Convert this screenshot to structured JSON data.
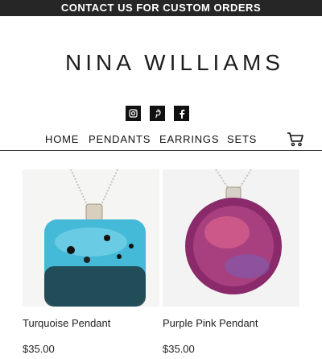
{
  "banner": {
    "text": "CONTACT US FOR CUSTOM ORDERS"
  },
  "brand": {
    "name": "NINA WILLIAMS"
  },
  "social": [
    {
      "icon": "instagram-icon"
    },
    {
      "icon": "pinterest-icon"
    },
    {
      "icon": "facebook-icon"
    }
  ],
  "nav": {
    "items": [
      {
        "label": "HOME"
      },
      {
        "label": "PENDANTS"
      },
      {
        "label": "EARRINGS"
      },
      {
        "label": "SETS"
      }
    ],
    "cart_icon": "cart-icon"
  },
  "products": [
    {
      "title": "Turquoise Pendant",
      "price": "$35.00",
      "accent": "#3fb6d6"
    },
    {
      "title": "Purple Pink Pendant",
      "price": "$35.00",
      "accent": "#9e2f72"
    }
  ]
}
